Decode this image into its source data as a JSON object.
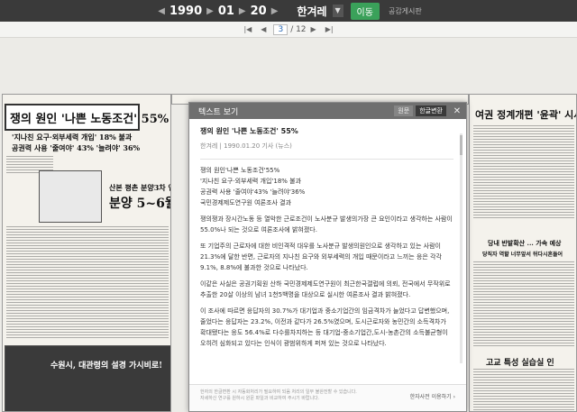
{
  "topbar": {
    "year": "1990",
    "month": "01",
    "day": "20",
    "paper": "한겨레",
    "go_label": "이동",
    "info_label": "공감게시판"
  },
  "pagebar": {
    "current_page": "3",
    "total_pages": "/ 12"
  },
  "newspaper": {
    "left_headline": "쟁의 원인 '나쁜 노동조건' 55%",
    "left_subhead_1": "'지나친 요구·외부세력 개입' 18% 불과",
    "left_subhead_2": "공권력 사용 '줄여야' 43% '늘려야' 36%",
    "left_bottom_headline": "분양 5~6월로",
    "left_small": "산본 평촌 분양3차 연기",
    "left_bottom_photo_caption": "수원시, 대관령의 설경 가시비로!",
    "right_headline": "여권 정계개편 '윤곽' 시사",
    "right_sub": "당내 반발확산 ... 가속 예상",
    "right_sub2": "당직자 역할 너무앞서 뒤다시흔들어",
    "right_bottom": "고교 특성 실습실 인"
  },
  "modal": {
    "title": "텍스트 보기",
    "btn_original": "원문",
    "btn_hangul": "한글변환",
    "close": "✕",
    "article_title": "쟁의 원인 '나쁜 노동조건' 55%",
    "meta": "한겨레 | 1990.01.20 기사 (뉴스)",
    "lead": "쟁의 원인'나쁜 노동조건'55%\n'지나친 요구·외부세력 개입'18% 불과\n공권력 사용 '줄여야'43% '늘려야'36%\n국민경제제도연구원 여론조사 결과",
    "p1": "쟁의쟁과 장시간노동 등 열악한 근로조건이 노사분규 발생의가장 큰 요인이라고 생각하는 사람이 55.0%나 되는 것으로 여론조사에 밝혀졌다.",
    "p2": "또 기업주의 근로자에 대한 비인격적 대우를 노사분규 발생의원인으로 생각하고 있는 사람이21.3%에 달한 반면, 근로자의 지나친 요구와 외부세력의 개입 때문이라고 느끼는 응은 각각 9.1%, 8.8%에 불과한 것으로 나타났다.",
    "p3": "이같은 사실은 공권기획원 산하 국민경제제도연구원이 최근한국갤럽에 의뢰, 전국에서 무작위로 추출한 20살 이상의 남녀 1천5백명을 대상으로 실시한 여론조사 결과 밝혀졌다.",
    "p4": "이 조사에 따르면 응답자의 30.7%가 대기업과 중소기업간의 임금격차가 늘었다고 답변했으며,줄었다는 응답자는 23.2%, 이전과 같다가 26.5%였으며, 도시근로자와 농민간의 소득격차가 확대됐다는 응도 56.4%로 다수를차지하는 등 대기업-중소기업간,도시-농촌간의 소득불균형이 오히려 심화되고 있다는 인식이 광범위하게 퍼져 있는 것으로 나타났다.",
    "footer_1": "한자의 한글변환 시 자동화처리가 필요하여 되움 처리의 일부 불완전할 수 있습니다.",
    "footer_2": "자세하신 연구를 원하시 원문 파일과 비교하여 주시기 바랍니다.",
    "footer_button": "한자사전 이용하기 ›"
  },
  "colors": {
    "accent_green": "#3aa15a",
    "topbar_bg": "#3a3a3a",
    "modal_header": "#6f6f6f"
  }
}
